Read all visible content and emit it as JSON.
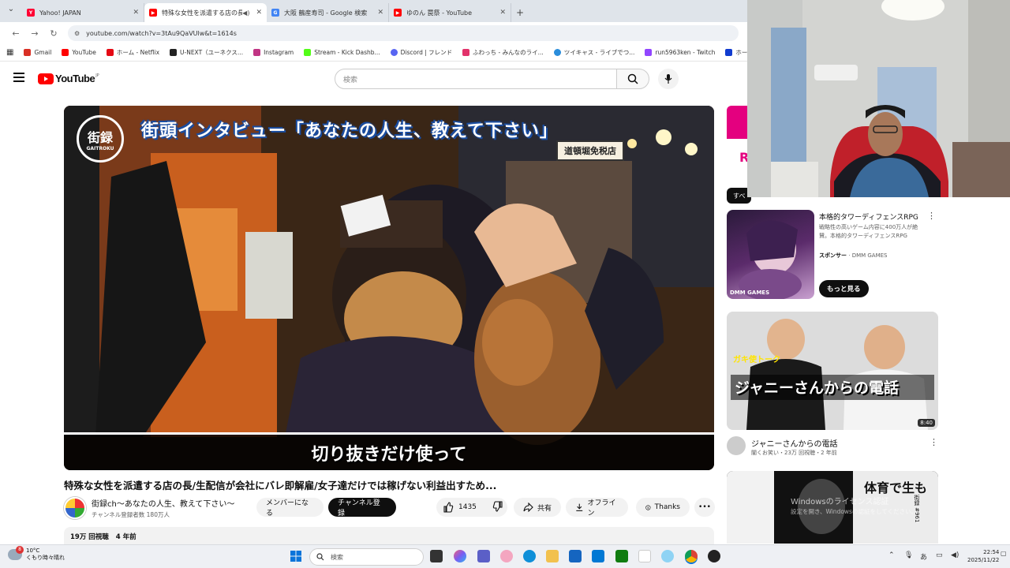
{
  "browser": {
    "tabs": [
      {
        "title": "Yahoo! JAPAN",
        "favicon_color": "#ff0033",
        "favicon_text": "Y!",
        "active": false
      },
      {
        "title": "特殊な女性を派遣する店の長/生",
        "favicon_color": "#ff0000",
        "favicon_text": "▶",
        "active": true
      },
      {
        "title": "大阪 鶴産寿司 - Google 検索",
        "favicon_color": "#4285f4",
        "favicon_text": "G",
        "active": false
      },
      {
        "title": "ゆのん  罠祭 - YouTube",
        "favicon_color": "#ff0000",
        "favicon_text": "▶",
        "active": false
      }
    ],
    "url": "youtube.com/watch?v=3tAu9QaVUlw&t=1614s",
    "bookmarks": [
      {
        "label": "Gmail",
        "color": "#d93025"
      },
      {
        "label": "YouTube",
        "color": "#ff0000"
      },
      {
        "label": "ホーム - Netflix",
        "color": "#e50914"
      },
      {
        "label": "U-NEXT（ユーネクス...",
        "color": "#222222"
      },
      {
        "label": "Instagram",
        "color": "#c13584"
      },
      {
        "label": "Stream - Kick Dashb...",
        "color": "#53fc18"
      },
      {
        "label": "Discord | フレンド",
        "color": "#5865f2"
      },
      {
        "label": "ふわっち - みんなのライ...",
        "color": "#e2336b"
      },
      {
        "label": "ツイキャス - ライブでつ...",
        "color": "#2a8ddb"
      },
      {
        "label": "run5963ken - Twitch",
        "color": "#9146ff"
      },
      {
        "label": "ホーム | Disney+(デ",
        "color": "#113ccf"
      }
    ]
  },
  "youtube": {
    "logo_text": "YouTube",
    "region": "JP",
    "search_placeholder": "検索",
    "video": {
      "overlay_title": "街頭インタビュー「あなたの人生、教えて下さい」",
      "channel_logo_text": "街録",
      "channel_logo_sub": "GAITROKU",
      "sign_text": "道頓堀免税店",
      "caption": "切り抜きだけ使って",
      "title": "特殊な女性を派遣する店の長/生配信が会社にバレ即解雇/女子達だけでは稼げない利益出すため...",
      "channel_name": "街録ch〜あなたの人生、教えて下さい〜",
      "subscribers": "チャンネル登録者数 180万人",
      "join_label": "メンバーになる",
      "subscribe_label": "チャンネル登録",
      "likes": "1435",
      "share_label": "共有",
      "offline_label": "オフライン",
      "thanks_label": "Thanks",
      "views": "19万 回視聴",
      "age": "4 年前"
    },
    "sidebar": {
      "chip_label": "すべ",
      "ad": {
        "title": "本格的タワーディフェンスRPG",
        "desc": "戦略性の高いゲーム内容に400万人が絶賛。本格的タワーディフェンスRPG",
        "sponsor_label": "スポンサー",
        "sponsor": "DMM GAMES",
        "more_label": "もっと見る",
        "thumb_text": "DMM GAMES"
      },
      "items": [
        {
          "title": "ジャニーさんからの電話",
          "channel": "闇くお笑い",
          "meta": "23万 回視聴・2 年前",
          "duration": "8:40",
          "thumb_caption": "ジャニーさんからの電話",
          "thumb_tag": "ガキ使トーク"
        },
        {
          "thumb_caption": "体育で生も",
          "thumb_tag": "街録 #961"
        }
      ],
      "watermark_line1": "Windowsのライセンス認証",
      "watermark_line2": "設定を開き、Windowsの認証をしてください。"
    }
  },
  "taskbar": {
    "temperature": "10°C",
    "weather": "くもり時々晴れ",
    "badge": "8",
    "search_placeholder": "検索",
    "time": "22:54",
    "date": "2025/11/22"
  },
  "colors": {
    "youtube_red": "#ff0000",
    "subscribe_bg": "#0f0f0f",
    "chip_bg": "#0f0f0f"
  }
}
